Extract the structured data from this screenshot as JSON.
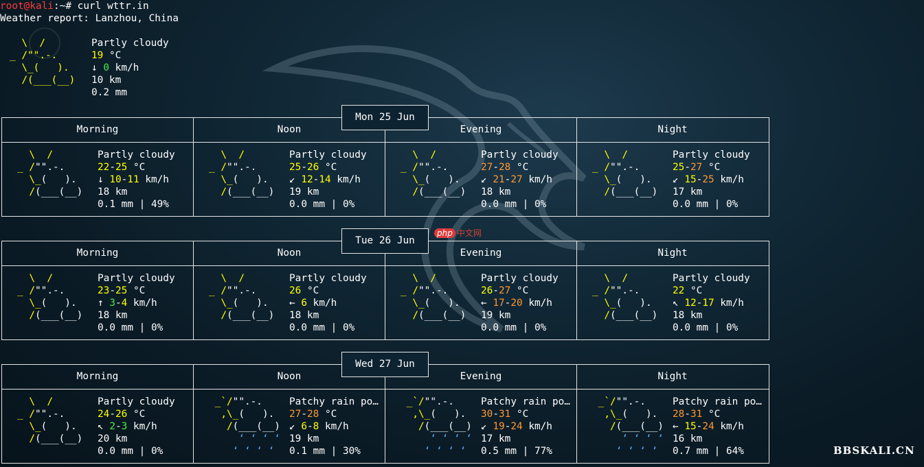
{
  "terminal": {
    "user": "root@kali",
    "sep": ":",
    "path": "~",
    "prompt": "# ",
    "command": "curl wttr.in",
    "report_title": "Weather report: Lanzhou, China"
  },
  "current": {
    "art": [
      "  \\  /",
      "_ /\"\".-.",
      "  \\_(   ).",
      "  /(___(__)"
    ],
    "condition": "Partly cloudy",
    "temp": "19",
    "temp_unit": " °C",
    "wind_dir": "↓ ",
    "wind": "0",
    "wind_unit": " km/h",
    "visibility": "10 km",
    "precip": "0.2 mm"
  },
  "days": [
    {
      "date": "Mon 25 Jun",
      "periods": [
        {
          "label": "Morning",
          "art": "partly",
          "condition": "Partly cloudy",
          "t1": "22",
          "t2": "25",
          "t1c": "y",
          "t2c": "y",
          "dir": "↓",
          "w1": "10",
          "w2": "11",
          "w1c": "y",
          "w2c": "y",
          "vis": "18 km",
          "precip": "0.1 mm | 49%"
        },
        {
          "label": "Noon",
          "art": "partly",
          "condition": "Partly cloudy",
          "t1": "25",
          "t2": "26",
          "t1c": "y",
          "t2c": "y",
          "dir": "↙",
          "w1": "12",
          "w2": "14",
          "w1c": "y",
          "w2c": "y",
          "vis": "19 km",
          "precip": "0.0 mm | 0%"
        },
        {
          "label": "Evening",
          "art": "partly",
          "condition": "Partly cloudy",
          "t1": "27",
          "t2": "28",
          "t1c": "o",
          "t2c": "o",
          "dir": "↙",
          "w1": "21",
          "w2": "27",
          "w1c": "o",
          "w2c": "o",
          "vis": "18 km",
          "precip": "0.0 mm | 0%"
        },
        {
          "label": "Night",
          "art": "partly",
          "condition": "Partly cloudy",
          "t1": "25",
          "t2": "27",
          "t1c": "y",
          "t2c": "o",
          "dir": "↙",
          "w1": "15",
          "w2": "25",
          "w1c": "y",
          "w2c": "o",
          "vis": "17 km",
          "precip": "0.0 mm | 0%"
        }
      ]
    },
    {
      "date": "Tue 26 Jun",
      "periods": [
        {
          "label": "Morning",
          "art": "partly",
          "condition": "Partly cloudy",
          "t1": "23",
          "t2": "25",
          "t1c": "y",
          "t2c": "y",
          "dir": "↑",
          "w1": "3",
          "w2": "4",
          "w1c": "g",
          "w2c": "y",
          "vis": "18 km",
          "precip": "0.0 mm | 0%"
        },
        {
          "label": "Noon",
          "art": "partly",
          "condition": "Partly cloudy",
          "t1": "26",
          "t2": "",
          "t1c": "y",
          "t2c": "y",
          "dir": "←",
          "w1": "6",
          "w2": "",
          "w1c": "y",
          "w2c": "y",
          "vis": "18 km",
          "precip": "0.0 mm | 0%"
        },
        {
          "label": "Evening",
          "art": "partly",
          "condition": "Partly cloudy",
          "t1": "26",
          "t2": "27",
          "t1c": "y",
          "t2c": "o",
          "dir": "←",
          "w1": "17",
          "w2": "20",
          "w1c": "o",
          "w2c": "o",
          "vis": "19 km",
          "precip": "0.0 mm | 0%"
        },
        {
          "label": "Night",
          "art": "partly",
          "condition": "Partly cloudy",
          "t1": "22",
          "t2": "",
          "t1c": "y",
          "t2c": "y",
          "dir": "↖",
          "w1": "12",
          "w2": "17",
          "w1c": "y",
          "w2c": "y",
          "vis": "18 km",
          "precip": "0.0 mm | 0%"
        }
      ]
    },
    {
      "date": "Wed 27 Jun",
      "periods": [
        {
          "label": "Morning",
          "art": "partly",
          "condition": "Partly cloudy",
          "t1": "24",
          "t2": "26",
          "t1c": "y",
          "t2c": "y",
          "dir": "↖",
          "w1": "2",
          "w2": "3",
          "w1c": "g",
          "w2c": "g",
          "vis": "20 km",
          "precip": "0.0 mm | 0%"
        },
        {
          "label": "Noon",
          "art": "rain",
          "condition": "Patchy rain po…",
          "t1": "27",
          "t2": "28",
          "t1c": "o",
          "t2c": "o",
          "dir": "↙",
          "w1": "6",
          "w2": "8",
          "w1c": "y",
          "w2c": "y",
          "vis": "19 km",
          "precip": "0.1 mm | 30%"
        },
        {
          "label": "Evening",
          "art": "rain",
          "condition": "Patchy rain po…",
          "t1": "30",
          "t2": "31",
          "t1c": "o",
          "t2c": "o",
          "dir": "↙",
          "w1": "19",
          "w2": "24",
          "w1c": "o",
          "w2c": "o",
          "vis": "17 km",
          "precip": "0.5 mm | 77%"
        },
        {
          "label": "Night",
          "art": "rain",
          "condition": "Patchy rain po…",
          "t1": "28",
          "t2": "31",
          "t1c": "o",
          "t2c": "o",
          "dir": "←",
          "w1": "15",
          "w2": "24",
          "w1c": "y",
          "w2c": "o",
          "vis": "16 km",
          "precip": "0.7 mm | 64%"
        }
      ]
    }
  ],
  "arts": {
    "partly": [
      "\\  /",
      "_ /\"\".-.",
      "  \\_(   ).",
      "  /(___(__)",
      ""
    ],
    "rain": [
      " _`/\"\".-.",
      "  ,\\_(   ).",
      "   /(___(__)",
      "     ‘ ‘ ‘ ‘",
      "    ‘ ‘ ‘ ‘"
    ]
  },
  "watermarks": {
    "site": "BBSKALI.CN",
    "php_badge": "php",
    "php_text": "中文网"
  },
  "colors": {
    "background": "#0b1c27",
    "prompt_user": "#ff3b3b",
    "yellow": "#ffff00",
    "orange": "#ff9933",
    "green": "#44ee44",
    "rain": "#5aa7ff"
  }
}
